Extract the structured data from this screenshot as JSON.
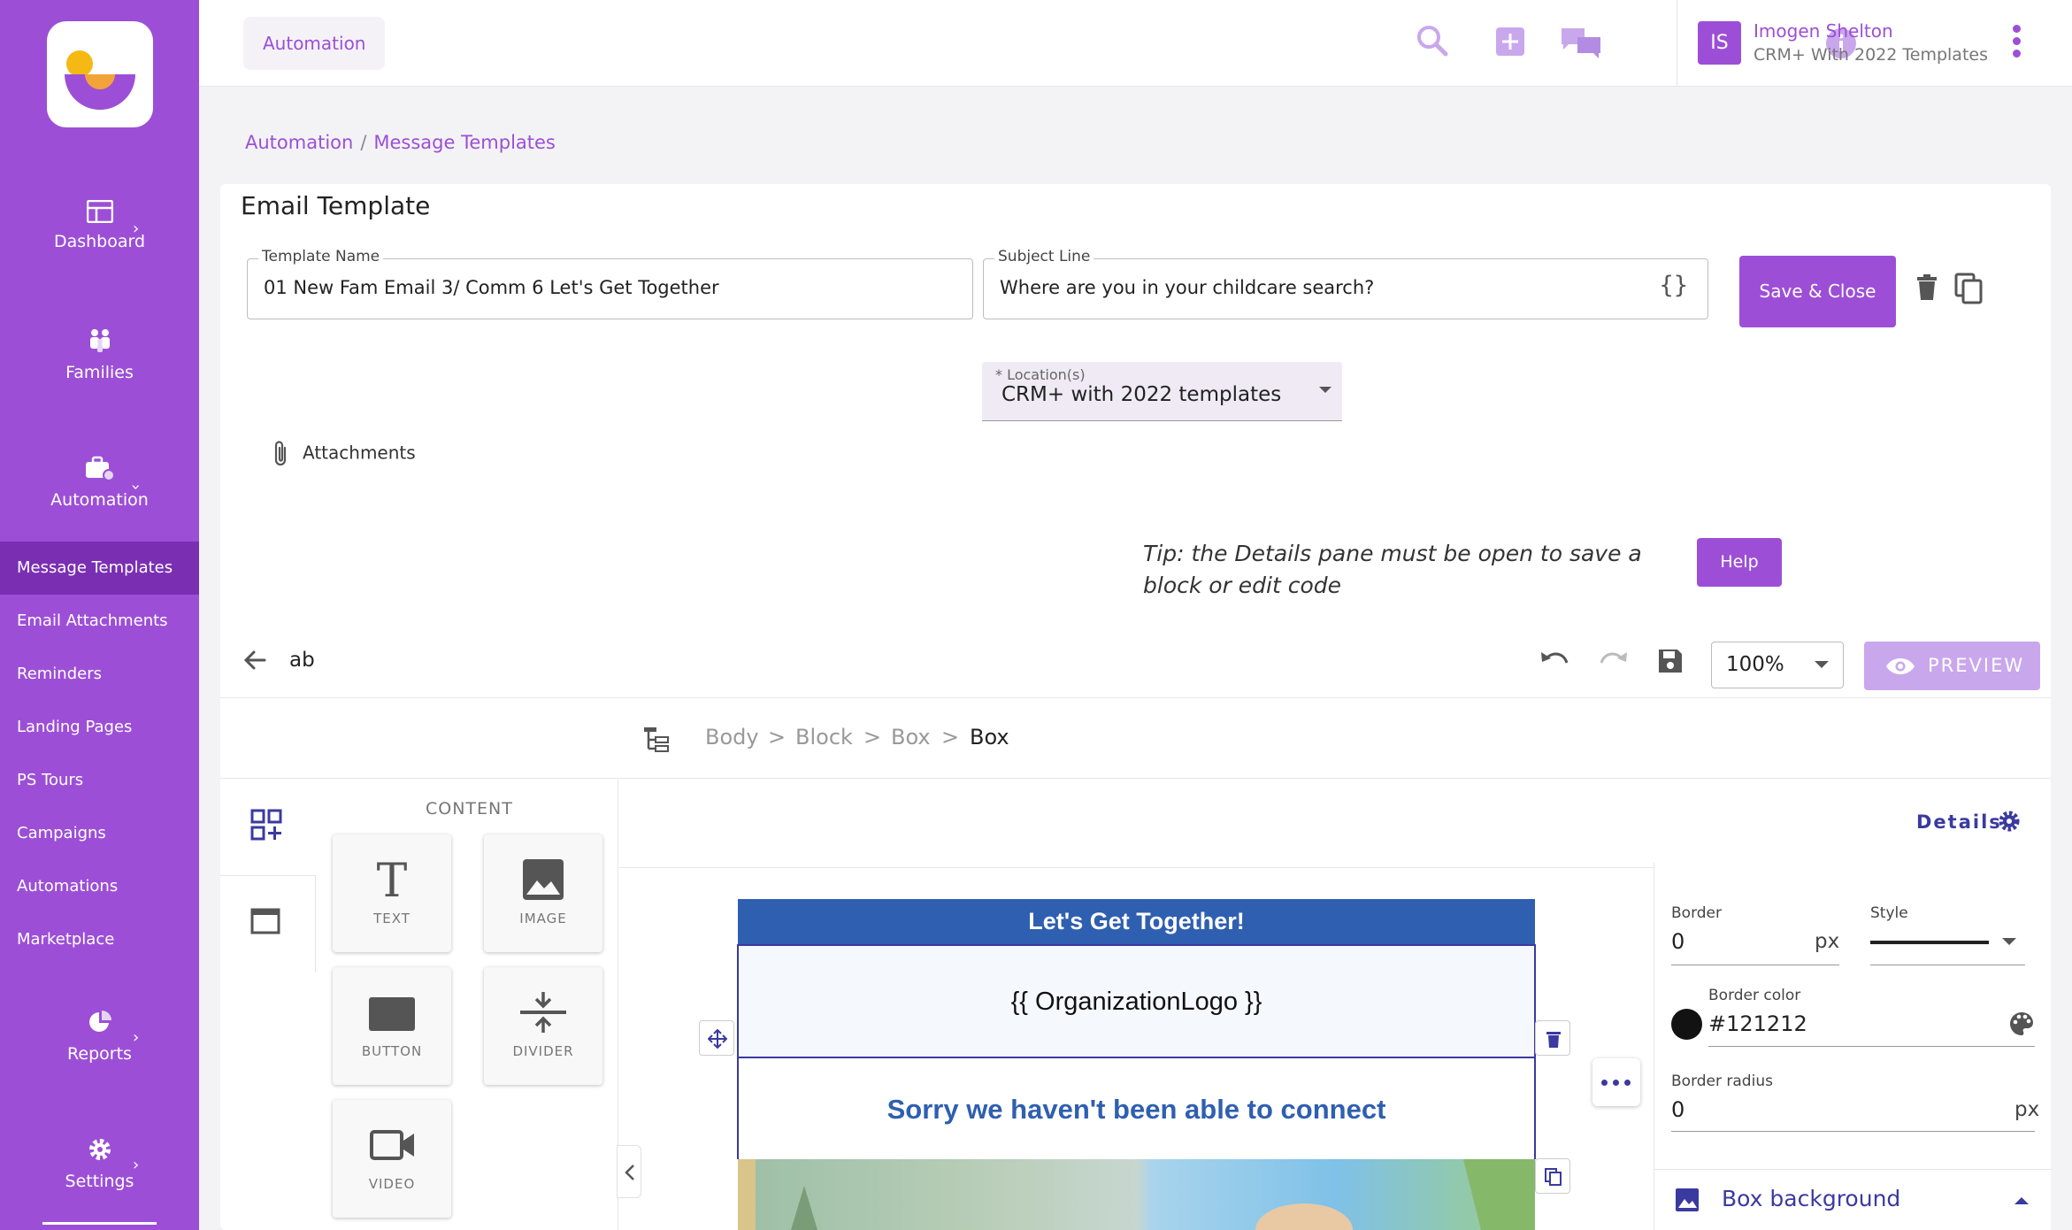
{
  "app": {
    "top_section": "Automation",
    "user_initials": "IS",
    "user_name": "Imogen Shelton",
    "user_org": "CRM+ With 2022 Templates",
    "accent_color": "#9c4fd6"
  },
  "sidebar": {
    "main": [
      {
        "label": "Dashboard",
        "icon": "dashboard-icon"
      },
      {
        "label": "Families",
        "icon": "families-icon"
      },
      {
        "label": "Automation",
        "icon": "automation-icon"
      },
      {
        "label": "Reports",
        "icon": "pie-chart-icon"
      },
      {
        "label": "Settings",
        "icon": "gear-icon"
      }
    ],
    "sub": [
      {
        "label": "Message Templates",
        "active": true
      },
      {
        "label": "Email Attachments"
      },
      {
        "label": "Reminders"
      },
      {
        "label": "Landing Pages"
      },
      {
        "label": "PS Tours"
      },
      {
        "label": "Campaigns"
      },
      {
        "label": "Automations"
      },
      {
        "label": "Marketplace"
      }
    ]
  },
  "breadcrumb": {
    "root": "Automation",
    "sep": "/",
    "current": "Message Templates"
  },
  "template": {
    "title": "Email Template",
    "name_label": "Template Name",
    "name_value": "01 New Fam Email 3/ Comm 6 Let's Get Together",
    "subject_label": "Subject Line",
    "subject_value": "Where are you in your childcare search?",
    "braces": "{}",
    "save_label": "Save & Close",
    "location_label": "* Location(s)",
    "location_value": "CRM+ with 2022 templates",
    "attachments_label": "Attachments",
    "tip": "Tip: the Details pane must be open to save a block or edit code",
    "help_label": "Help"
  },
  "editor": {
    "name": "ab",
    "zoom": "100%",
    "preview_label": "PREVIEW",
    "path": [
      "Body",
      ">",
      "Block",
      ">",
      "Box",
      ">",
      "Box"
    ],
    "content_title": "CONTENT",
    "blocks": [
      {
        "label": "TEXT",
        "icon": "text-icon"
      },
      {
        "label": "IMAGE",
        "icon": "image-icon"
      },
      {
        "label": "BUTTON",
        "icon": "button-icon"
      },
      {
        "label": "DIVIDER",
        "icon": "divider-icon"
      },
      {
        "label": "VIDEO",
        "icon": "video-icon"
      }
    ],
    "details_label": "Details"
  },
  "email": {
    "header": "Let's Get Together!",
    "logo_placeholder": "{{ OrganizationLogo }}",
    "subheading": "Sorry we haven't been able to connect",
    "header_color": "#2f5fb0"
  },
  "details": {
    "border_label": "Border",
    "border_value": "0",
    "border_unit": "px",
    "style_label": "Style",
    "border_color_label": "Border color",
    "border_color_value": "#121212",
    "border_radius_label": "Border radius",
    "border_radius_value": "0",
    "border_radius_unit": "px",
    "box_background_label": "Box background"
  }
}
